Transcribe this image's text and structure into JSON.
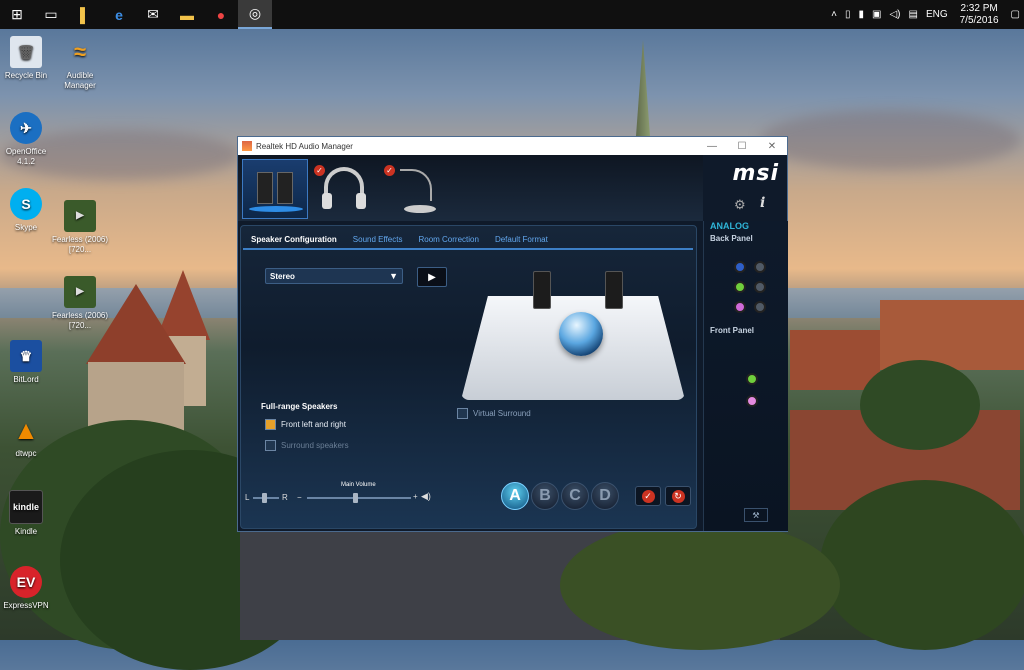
{
  "taskbar": {
    "apps": [
      "start-icon",
      "task-view-icon",
      "file-icon",
      "edge-icon",
      "mail-icon",
      "explorer-icon",
      "app-icon",
      "audio-app-icon"
    ],
    "clock_time": "2:32 PM",
    "clock_date": "7/5/2016",
    "language": "ENG"
  },
  "desktop_icons": [
    {
      "label": "Recycle Bin",
      "icon": "recycle-bin-icon",
      "color": "#cfd8e2"
    },
    {
      "label": "Audible Manager",
      "icon": "audible-icon",
      "color": "#f0a020"
    },
    {
      "label": "OpenOffice 4.1.2",
      "icon": "openoffice-icon",
      "color": "#1b6fc2"
    },
    {
      "label": "Skype",
      "icon": "skype-icon",
      "color": "#00aff0"
    },
    {
      "label": "Fearless (2006) [720...",
      "icon": "video-file-icon",
      "color": "#3a5a2a"
    },
    {
      "label": "Fearless (2006) [720...",
      "icon": "video-file-icon",
      "color": "#3a5a2a"
    },
    {
      "label": "BitLord",
      "icon": "bitlord-icon",
      "color": "#1b4fa0"
    },
    {
      "label": "dtwpc",
      "icon": "vlc-icon",
      "color": "#f08a00"
    },
    {
      "label": "Kindle",
      "icon": "kindle-icon",
      "color": "#1a1a1a"
    },
    {
      "label": "ExpressVPN",
      "icon": "expressvpn-icon",
      "color": "#d8232a"
    }
  ],
  "window": {
    "title": "Realtek HD Audio Manager",
    "logo": "msi",
    "tabs": [
      "Speaker Configuration",
      "Sound Effects",
      "Room Correction",
      "Default Format"
    ],
    "active_tab": "Speaker Configuration",
    "speaker_config_value": "Stereo",
    "virtual_surround_label": "Virtual Surround",
    "full_range_title": "Full-range Speakers",
    "front_lr_label": "Front left and right",
    "surround_label": "Surround speakers",
    "main_volume_label": "Main Volume",
    "balance_left": "L",
    "balance_right": "R",
    "vol_minus": "−",
    "vol_plus": "+",
    "presets": [
      "A",
      "B",
      "C",
      "D"
    ],
    "active_preset": "A",
    "analog_label": "ANALOG",
    "back_panel_label": "Back Panel",
    "front_panel_label": "Front Panel",
    "accent": "#3d7fc6"
  }
}
